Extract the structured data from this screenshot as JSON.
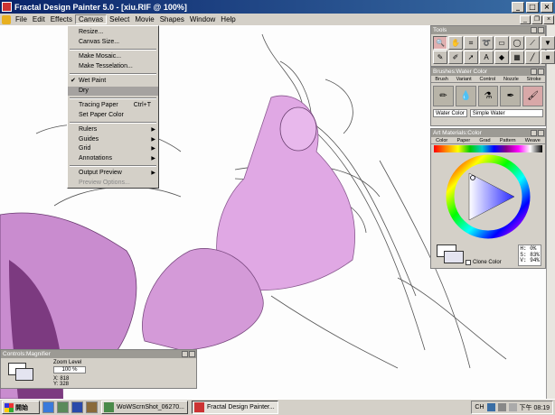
{
  "window": {
    "title": "Fractal Design Painter 5.0 - [xiu.RIF @ 100%]",
    "minimize_label": "_",
    "maximize_label": "□",
    "close_label": "×"
  },
  "menubar": {
    "items": [
      "File",
      "Edit",
      "Effects",
      "Canvas",
      "Select",
      "Movie",
      "Shapes",
      "Window",
      "Help"
    ],
    "active_index": 3
  },
  "canvas_menu": {
    "resize": "Resize...",
    "canvas_size": "Canvas Size...",
    "make_mosaic": "Make Mosaic...",
    "make_tesselation": "Make Tesselation...",
    "wet_paint": "Wet Paint",
    "dry": "Dry",
    "tracing_paper": "Tracing Paper",
    "tracing_paper_shortcut": "Ctrl+T",
    "set_paper_color": "Set Paper Color",
    "rulers": "Rulers",
    "guides": "Guides",
    "grid": "Grid",
    "annotations": "Annotations",
    "output_preview": "Output Preview",
    "preview_options": "Preview Options..."
  },
  "tools_palette": {
    "title": "Tools",
    "tools": [
      "magnifier-icon",
      "hand-icon",
      "crop-icon",
      "lasso-icon",
      "rectangle-select-icon",
      "oval-select-icon",
      "eyedropper-icon",
      "paint-bucket-icon",
      "pen-icon",
      "brush-icon",
      "pointer-icon",
      "text-icon",
      "shape-icon",
      "grid-icon",
      "line-icon",
      "square-icon"
    ]
  },
  "brushes_palette": {
    "title": "Brushes:Water Color",
    "tabs": [
      "Brush",
      "Variant",
      "Control",
      "Nozzle",
      "Stroke"
    ],
    "category": "Water Color",
    "variant": "Simple Water"
  },
  "art_materials_palette": {
    "title": "Art Materials:Color",
    "tabs": [
      "Color",
      "Paper",
      "Grad",
      "Pattern",
      "Weave"
    ],
    "h_label": "H:",
    "h_value": "0%",
    "s_label": "S:",
    "s_value": "83%",
    "v_label": "V:",
    "v_value": "94%",
    "clone_color": "Clone Color"
  },
  "controls_panel": {
    "title": "Controls:Magnifier",
    "zoom_label": "Zoom Level",
    "zoom_value": "100 %",
    "x_readout": "X: 818",
    "y_readout": "Y: 328"
  },
  "taskbar": {
    "start": "開始",
    "tasks": [
      "WoWScrnShot_06270...",
      "Fractal Design Painter..."
    ],
    "active_task": 1,
    "lang": "CH",
    "clock": "下午 08:19"
  },
  "colors": {
    "title_bar": "#0a246a",
    "accent_purple": "#c07cc8",
    "hue_ring": "#ff0000",
    "current_color": "#f0a0a8"
  }
}
